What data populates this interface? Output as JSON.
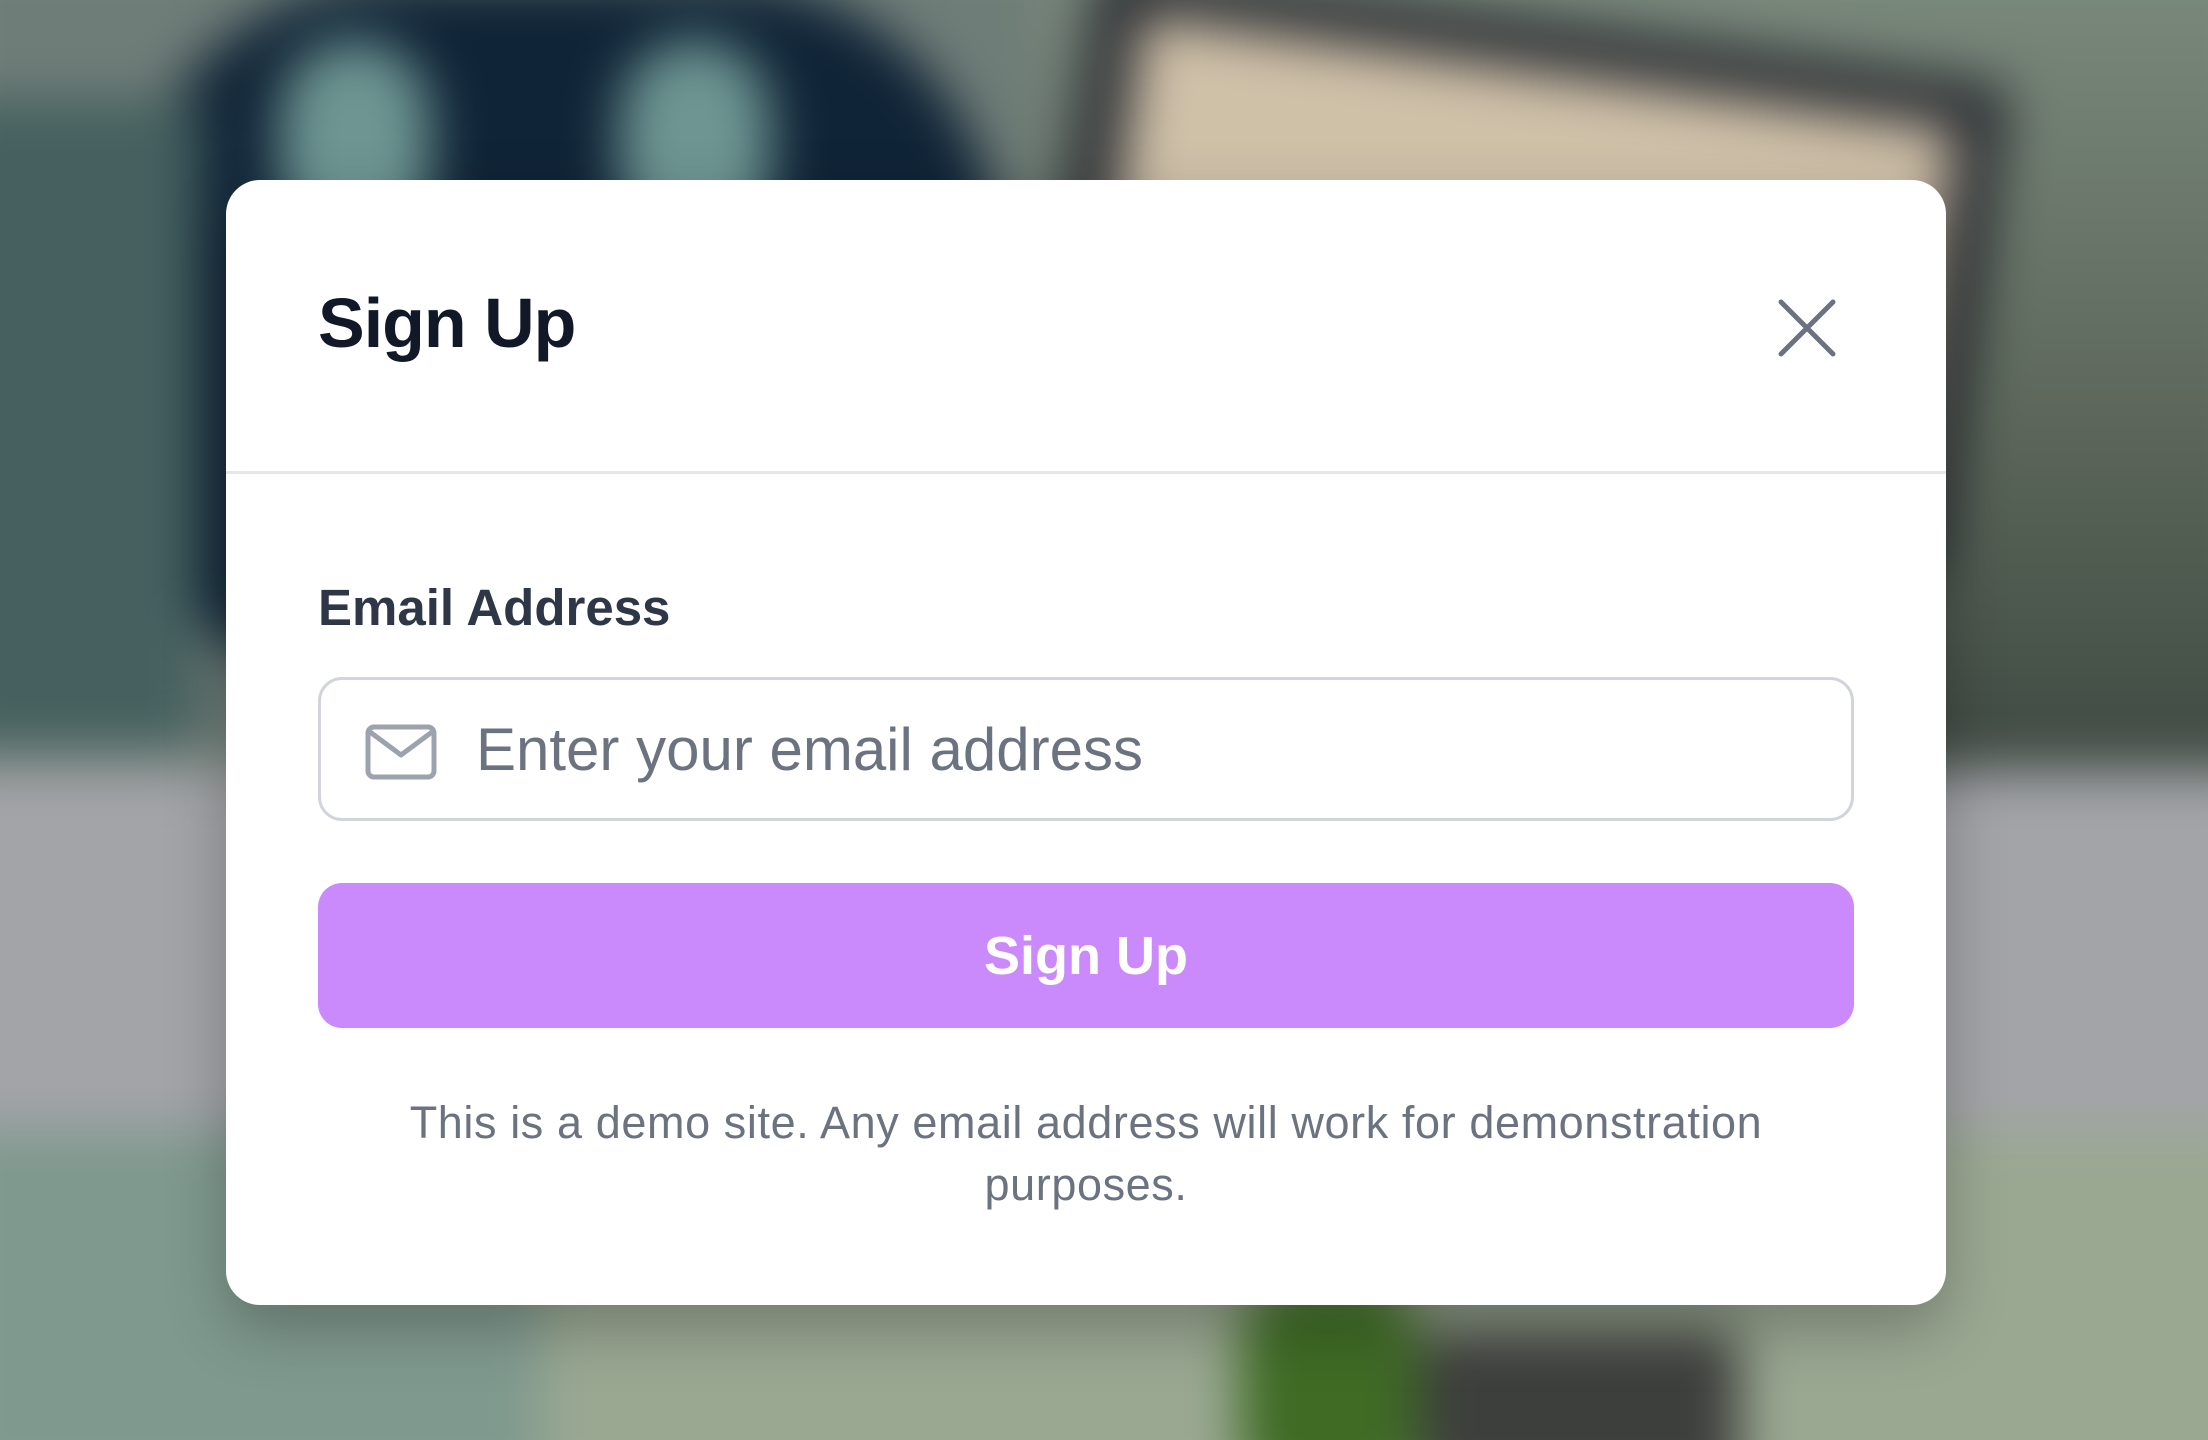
{
  "modal": {
    "title": "Sign Up",
    "close_icon": "close-icon",
    "email_label": "Email Address",
    "email_placeholder": "Enter your email address",
    "email_value": "",
    "email_icon": "mail-icon",
    "submit_label": "Sign Up",
    "disclaimer": "This is a demo site. Any email address will work for demonstration purposes."
  },
  "colors": {
    "button_background": "#cb8afc",
    "title_text": "#111827",
    "muted_text": "#6b7280",
    "overlay_background": "#7e8a7f"
  }
}
